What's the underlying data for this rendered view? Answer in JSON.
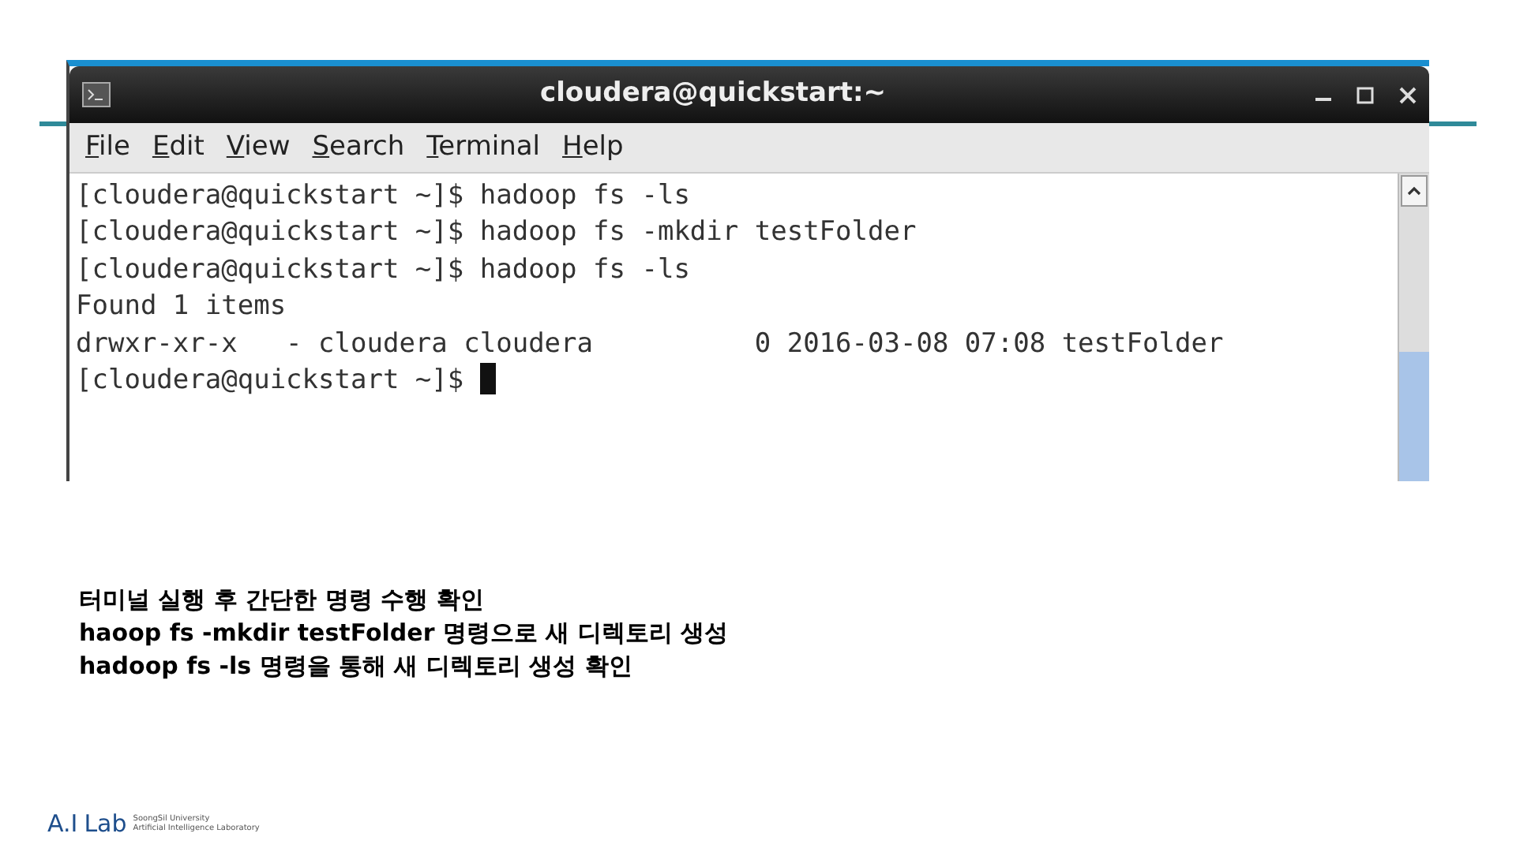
{
  "window": {
    "title": "cloudera@quickstart:~"
  },
  "menu": [
    {
      "label": "File"
    },
    {
      "label": "Edit"
    },
    {
      "label": "View"
    },
    {
      "label": "Search"
    },
    {
      "label": "Terminal"
    },
    {
      "label": "Help"
    }
  ],
  "terminal": {
    "lines": [
      "[cloudera@quickstart ~]$ hadoop fs -ls",
      "[cloudera@quickstart ~]$ hadoop fs -mkdir testFolder",
      "[cloudera@quickstart ~]$ hadoop fs -ls",
      "Found 1 items",
      "drwxr-xr-x   - cloudera cloudera          0 2016-03-08 07:08 testFolder",
      "[cloudera@quickstart ~]$ "
    ],
    "cursor": true
  },
  "notes": [
    "터미널 실행 후 간단한 명령 수행 확인",
    "haoop fs -mkdir testFolder 명령으로 새 디렉토리 생성",
    "hadoop fs -ls 명령을 통해 새 디렉토리 생성 확인"
  ],
  "logo": {
    "mark": "A.I",
    "word": "Lab",
    "line_1": "SoongSil University",
    "line_2": "Artificial Intelligence Laboratory"
  }
}
